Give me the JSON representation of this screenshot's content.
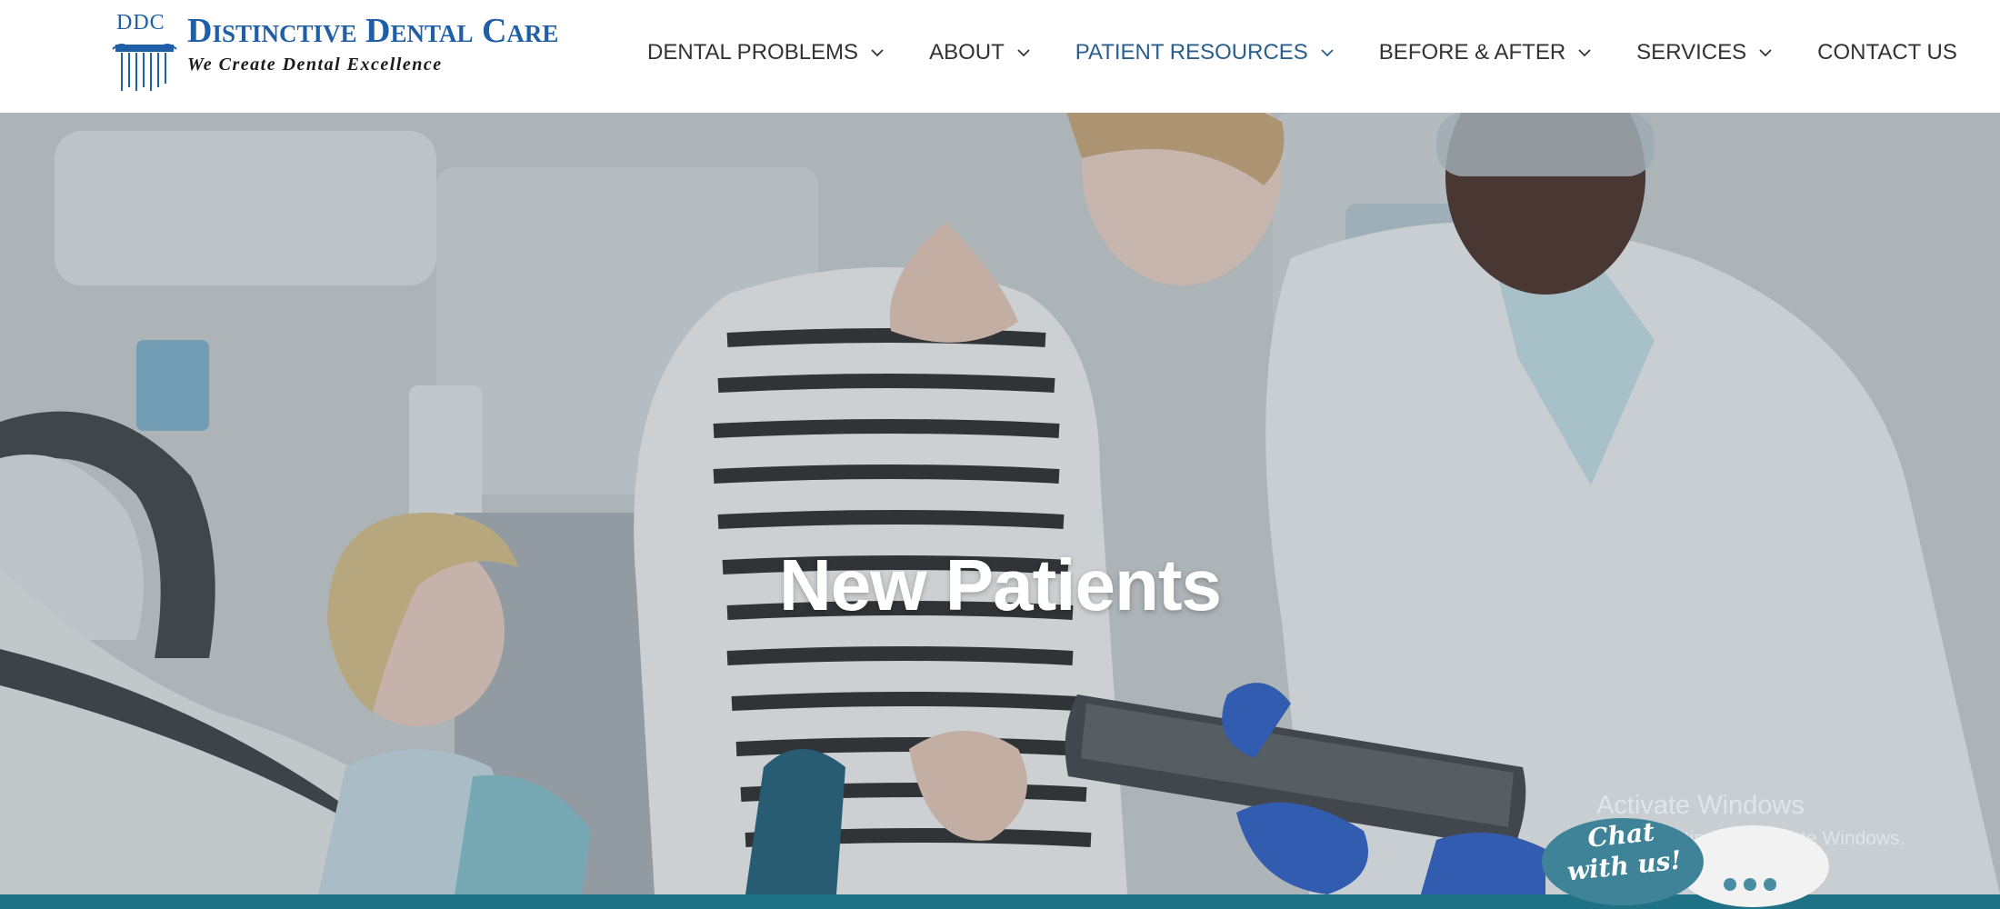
{
  "logo": {
    "abbr": "DDC",
    "name": "Distinctive Dental Care",
    "tagline": "We Create Dental Excellence"
  },
  "nav": {
    "items": [
      {
        "label": "DENTAL PROBLEMS",
        "has_dropdown": true,
        "active": false
      },
      {
        "label": "ABOUT",
        "has_dropdown": true,
        "active": false
      },
      {
        "label": "PATIENT RESOURCES",
        "has_dropdown": true,
        "active": true
      },
      {
        "label": "BEFORE & AFTER",
        "has_dropdown": true,
        "active": false
      },
      {
        "label": "SERVICES",
        "has_dropdown": true,
        "active": false
      },
      {
        "label": "CONTACT US",
        "has_dropdown": false,
        "active": false
      }
    ],
    "dropdown_icon": "chevron-down-icon"
  },
  "hero": {
    "title": "New Patients"
  },
  "watermark": {
    "line1": "Activate Windows",
    "line2": "Go to Settings to activate Windows."
  },
  "chat": {
    "label_line1": "Chat",
    "label_line2": "with us!",
    "icon": "typing-dots-icon"
  },
  "colors": {
    "brand_blue": "#1f5fa8",
    "nav_text": "#333333",
    "nav_active": "#2a5e8c",
    "teal_bar": "#1f7185",
    "chat_bubble": "#3f8398"
  }
}
